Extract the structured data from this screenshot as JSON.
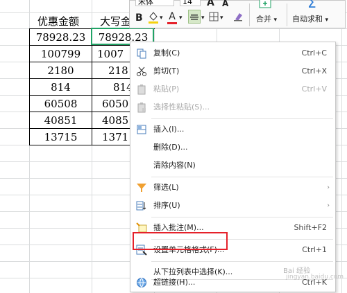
{
  "sheet": {
    "headers": [
      "优惠金额",
      "大写金额"
    ],
    "col_a": [
      "78928.23",
      "100799",
      "2180",
      "814",
      "60508",
      "40851",
      "13715"
    ],
    "col_b": [
      "78928.23",
      "1007",
      "218",
      "814",
      "6050",
      "4085",
      "1371"
    ]
  },
  "toolbar": {
    "font_name": "宋体",
    "font_size": "14",
    "bold": "B",
    "font_color": "A",
    "grow_font": "A",
    "shrink_font": "A",
    "merge_label": "合并",
    "autosum_label": "自动求和",
    "dropdown_arrow": "▾",
    "accent_red": "#e5212a",
    "accent_green": "#21a366"
  },
  "menu": {
    "copy": {
      "label": "复制(C)",
      "shortcut": "Ctrl+C"
    },
    "cut": {
      "label": "剪切(T)",
      "shortcut": "Ctrl+X"
    },
    "paste": {
      "label": "粘贴(P)",
      "shortcut": "Ctrl+V"
    },
    "paste_special": {
      "label": "选择性粘贴(S)..."
    },
    "insert": {
      "label": "插入(I)..."
    },
    "delete": {
      "label": "删除(D)..."
    },
    "clear": {
      "label": "清除内容(N)"
    },
    "filter": {
      "label": "筛选(L)"
    },
    "sort": {
      "label": "排序(U)"
    },
    "insert_comment": {
      "label": "插入批注(M)...",
      "shortcut": "Shift+F2"
    },
    "format_cells": {
      "label": "设置单元格格式(F)...",
      "shortcut": "Ctrl+1"
    },
    "pick_from_list": {
      "label": "从下拉列表中选择(K)..."
    },
    "hyperlink": {
      "label": "超链接(H)...",
      "shortcut": "Ctrl+K"
    },
    "submenu_arrow": "›"
  },
  "watermark": {
    "text": "Bai 经验",
    "sub": "jingyan.baidu.com"
  }
}
